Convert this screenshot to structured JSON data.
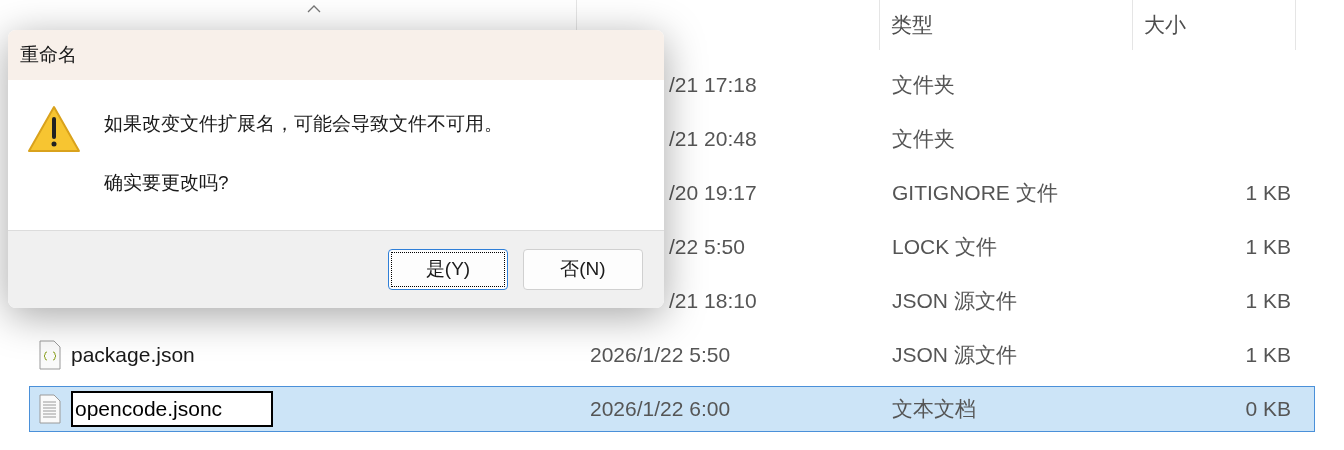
{
  "columns": [
    {
      "sorted": true
    },
    {
      "sorted": false
    },
    {
      "label": "类型",
      "sorted": false
    },
    {
      "label": "大小",
      "sorted": false
    }
  ],
  "rows": [
    {
      "modified": "/21 17:18",
      "type": "文件夹",
      "selected": false,
      "renaming": false
    },
    {
      "modified": "/21 20:48",
      "type": "文件夹",
      "selected": false,
      "renaming": false
    },
    {
      "modified": "/20 19:17",
      "type": "GITIGNORE 文件",
      "size": "1 KB",
      "selected": false,
      "renaming": false
    },
    {
      "modified": "/22 5:50",
      "type": "LOCK 文件",
      "size": "1 KB",
      "selected": false,
      "renaming": false
    },
    {
      "modified": "/21 18:10",
      "type": "JSON 源文件",
      "size": "1 KB",
      "selected": false,
      "renaming": false
    },
    {
      "kind": "json",
      "name": "package.json",
      "modified": "2026/1/22 5:50",
      "type": "JSON 源文件",
      "size": "1 KB",
      "selected": false,
      "renaming": false
    },
    {
      "kind": "text",
      "name": "opencode.jsonc",
      "modified": "2026/1/22 6:00",
      "type": "文本文档",
      "size": "0 KB",
      "selected": true,
      "renaming": true
    }
  ],
  "dialog": {
    "title": "重命名",
    "message": "如果改变文件扩展名，可能会导致文件不可用。",
    "question": "确实要更改吗?",
    "buttons": [
      {
        "label": "是(Y)",
        "focused": true
      },
      {
        "label": "否(N)",
        "focused": false
      }
    ]
  }
}
